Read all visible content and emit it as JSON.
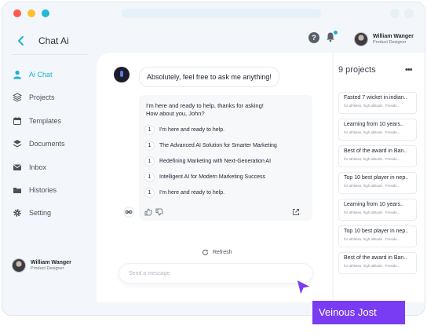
{
  "colors": {
    "accent": "#1bb1d4",
    "tag": "#7a3cf2",
    "dot_red": "#ff5a4f",
    "dot_yellow": "#ffbf2e",
    "dot_teal": "#27b7d4"
  },
  "app": {
    "title": "Chat Ai"
  },
  "sidebar": {
    "items": [
      {
        "label": "Ai Chat",
        "icon": "user-icon",
        "active": true
      },
      {
        "label": "Projects",
        "icon": "layers-icon"
      },
      {
        "label": "Templates",
        "icon": "calendar-icon"
      },
      {
        "label": "Documents",
        "icon": "stack-icon"
      },
      {
        "label": "Inbox",
        "icon": "mail-icon"
      },
      {
        "label": "Histories",
        "icon": "folder-icon"
      },
      {
        "label": "Setting",
        "icon": "gear-icon"
      }
    ],
    "user": {
      "name": "William  Wanger",
      "role": "Product Designer"
    }
  },
  "header": {
    "user": {
      "name": "William  Wanger",
      "role": "Product Designer"
    }
  },
  "chat": {
    "greeting": "Absolutely, feel free to ask me anything!",
    "response": {
      "intro_line1": "I'm here and ready to help, thanks for asking!",
      "intro_line2": "How about you, John?",
      "items": [
        {
          "num": "1",
          "text": "I'm here and ready to help."
        },
        {
          "num": "1",
          "text": "The Advanced AI Solution for Smarter Marketing"
        },
        {
          "num": "1",
          "text": "Redefining Marketing with Next-Generation AI"
        },
        {
          "num": "1",
          "text": "Intelligent AI for Modern Marketing Success"
        },
        {
          "num": "1",
          "text": "I'm here and ready to help."
        }
      ]
    },
    "refresh_label": "Refresh",
    "input_placeholder": "Send a message"
  },
  "projects": {
    "title": "9 projects",
    "items": [
      {
        "name": "Fasted 7 wicket in indian..",
        "sub": "for athletes, high altitude . Freside..."
      },
      {
        "name": "Learning from 10 years..",
        "sub": "for athletes, high altitude . Freside..."
      },
      {
        "name": "Best of the award in Ban..",
        "sub": "for athletes, high altitude . Freside..."
      },
      {
        "name": "Top 10 best player in nep..",
        "sub": "for athletes, high altitude . Freside..."
      },
      {
        "name": "Learning from 10 years..",
        "sub": "for athletes, high altitude . Freside..."
      },
      {
        "name": "Top 10 best player in nep..",
        "sub": "for athletes, high altitude . Freside..."
      },
      {
        "name": "Best of the award in Ban..",
        "sub": "for athletes, high altitude . Freside..."
      }
    ]
  },
  "cursor_tag": {
    "label": "Veinous Jost"
  }
}
